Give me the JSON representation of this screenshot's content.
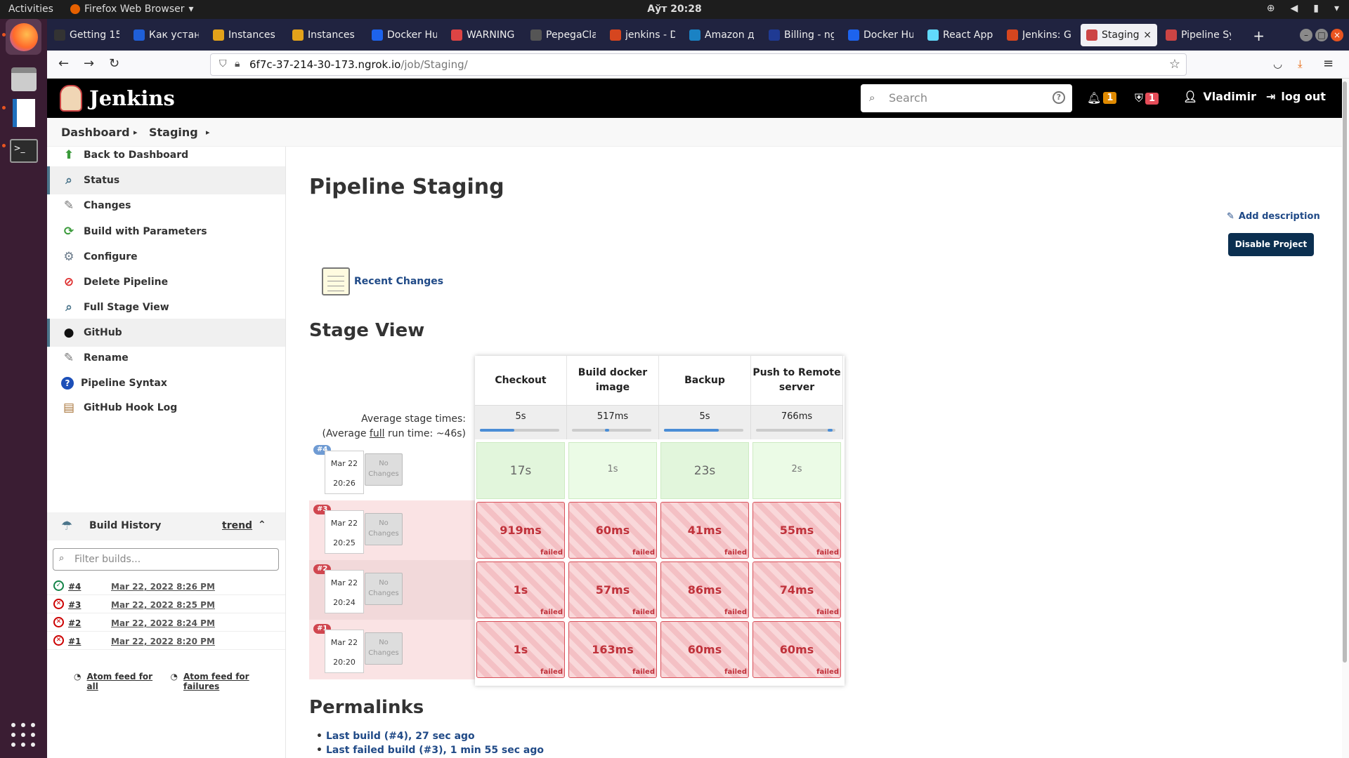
{
  "os": {
    "activities": "Activities",
    "app_menu": "Firefox Web Browser",
    "clock": "Аўт 20:28"
  },
  "browser": {
    "tabs": [
      {
        "label": "Getting 15",
        "color": "#333"
      },
      {
        "label": "Как устан",
        "color": "#1f5fd8"
      },
      {
        "label": "Instances |",
        "color": "#e3a21a"
      },
      {
        "label": "Instances",
        "color": "#e3a21a"
      },
      {
        "label": "Docker Hu",
        "color": "#1d63ed"
      },
      {
        "label": "WARNING",
        "color": "#d44"
      },
      {
        "label": "PepegaCla",
        "color": "#555"
      },
      {
        "label": "jenkins - D",
        "color": "#d6461f"
      },
      {
        "label": "Amazon д",
        "color": "#1a82c4"
      },
      {
        "label": "Billing - ng",
        "color": "#1f3a93"
      },
      {
        "label": "Docker Hu",
        "color": "#1d63ed"
      },
      {
        "label": "React App",
        "color": "#61dafb"
      },
      {
        "label": "Jenkins: Gi",
        "color": "#d6461f"
      },
      {
        "label": "Staging",
        "color": "#c44",
        "active": true
      },
      {
        "label": "Pipeline Sy",
        "color": "#c44"
      }
    ],
    "url_host": "6f7c-37-214-30-173.ngrok.io",
    "url_path": "/job/Staging/"
  },
  "header": {
    "logo_text": "Jenkins",
    "search_placeholder": "Search",
    "notifications_count": "1",
    "security_count": "1",
    "user": "Vladimir",
    "logout": "log out"
  },
  "breadcrumb": [
    "Dashboard",
    "Staging"
  ],
  "sidebar": {
    "items": [
      {
        "label": "Back to Dashboard",
        "icon": "arrow-up-icon"
      },
      {
        "label": "Status",
        "icon": "magnifier-icon",
        "active": true
      },
      {
        "label": "Changes",
        "icon": "notepad-icon"
      },
      {
        "label": "Build with Parameters",
        "icon": "build-icon"
      },
      {
        "label": "Configure",
        "icon": "gear-icon"
      },
      {
        "label": "Delete Pipeline",
        "icon": "no-entry-icon"
      },
      {
        "label": "Full Stage View",
        "icon": "magnifier-icon"
      },
      {
        "label": "GitHub",
        "icon": "github-icon",
        "active": true
      },
      {
        "label": "Rename",
        "icon": "notepad-icon"
      },
      {
        "label": "Pipeline Syntax",
        "icon": "help-icon"
      },
      {
        "label": "GitHub Hook Log",
        "icon": "clipboard-icon"
      }
    ],
    "build_history": {
      "title": "Build History",
      "trend": "trend",
      "filter_placeholder": "Filter builds...",
      "builds": [
        {
          "num": "#4",
          "date": "Mar 22, 2022 8:26 PM",
          "status": "success"
        },
        {
          "num": "#3",
          "date": "Mar 22, 2022 8:25 PM",
          "status": "failed"
        },
        {
          "num": "#2",
          "date": "Mar 22, 2022 8:24 PM",
          "status": "failed"
        },
        {
          "num": "#1",
          "date": "Mar 22, 2022 8:20 PM",
          "status": "failed"
        }
      ],
      "feed_all": "Atom feed for all",
      "feed_failures": "Atom feed for failures"
    }
  },
  "main": {
    "title": "Pipeline Staging",
    "add_description": "Add description",
    "disable_project": "Disable Project",
    "recent_changes": "Recent Changes",
    "stage_view_title": "Stage View",
    "avg_stage_times": "Average stage times:",
    "avg_full_prefix": "(Average ",
    "avg_full_word": "full",
    "avg_full_suffix": " run time: ~46s)",
    "stages": [
      {
        "name": "Checkout",
        "avg": "5s",
        "fill": 0.43
      },
      {
        "name": "Build docker image",
        "avg": "517ms",
        "fill": 0.05
      },
      {
        "name": "Backup",
        "avg": "5s",
        "fill": 0.68
      },
      {
        "name": "Push to Remote server",
        "avg": "766ms",
        "fill": 0.06
      }
    ],
    "runs": [
      {
        "badge": "#4",
        "date": "Mar 22",
        "time": "20:26",
        "no_changes": "No Changes",
        "status": "success",
        "cells": [
          {
            "v": "17s",
            "s": "ok"
          },
          {
            "v": "1s",
            "s": "ok"
          },
          {
            "v": "23s",
            "s": "ok"
          },
          {
            "v": "2s",
            "s": "ok"
          }
        ]
      },
      {
        "badge": "#3",
        "date": "Mar 22",
        "time": "20:25",
        "no_changes": "No Changes",
        "status": "failed",
        "cells": [
          {
            "v": "919ms",
            "s": "fail"
          },
          {
            "v": "60ms",
            "s": "fail"
          },
          {
            "v": "41ms",
            "s": "fail"
          },
          {
            "v": "55ms",
            "s": "fail"
          }
        ]
      },
      {
        "badge": "#2",
        "date": "Mar 22",
        "time": "20:24",
        "no_changes": "No Changes",
        "status": "failed",
        "cells": [
          {
            "v": "1s",
            "s": "fail"
          },
          {
            "v": "57ms",
            "s": "fail"
          },
          {
            "v": "86ms",
            "s": "fail"
          },
          {
            "v": "74ms",
            "s": "fail"
          }
        ]
      },
      {
        "badge": "#1",
        "date": "Mar 22",
        "time": "20:20",
        "no_changes": "No Changes",
        "status": "failed",
        "cells": [
          {
            "v": "1s",
            "s": "fail"
          },
          {
            "v": "163ms",
            "s": "fail"
          },
          {
            "v": "60ms",
            "s": "fail"
          },
          {
            "v": "60ms",
            "s": "fail"
          }
        ]
      }
    ],
    "failed_label": "failed",
    "permalinks_title": "Permalinks",
    "permalinks": [
      "Last build (#4), 27 sec ago",
      "Last failed build (#3), 1 min 55 sec ago"
    ]
  },
  "colors": {
    "accent": "#204a87",
    "fail": "#c0323b",
    "success": "#138347",
    "header_bg": "#000000"
  }
}
